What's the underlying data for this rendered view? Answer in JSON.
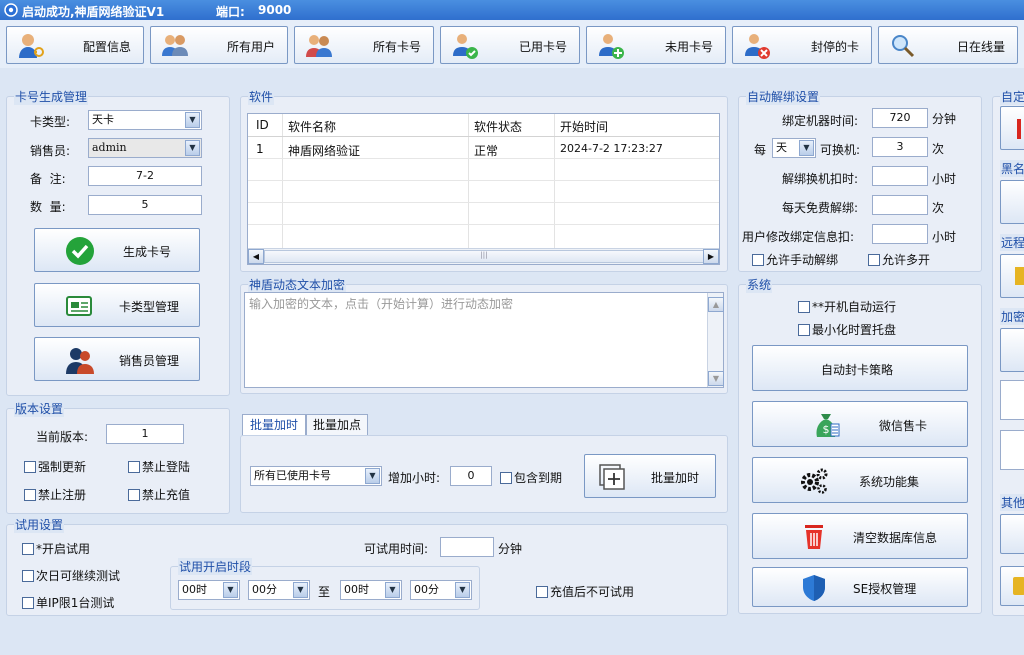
{
  "window": {
    "title": "启动成功,神盾网络验证V1",
    "port_label": "端口:",
    "port_value": "9000"
  },
  "toolbar": [
    {
      "label": "配置信息",
      "icon": "user-key-icon"
    },
    {
      "label": "所有用户",
      "icon": "users-icon"
    },
    {
      "label": "所有卡号",
      "icon": "cards-users-icon"
    },
    {
      "label": "已用卡号",
      "icon": "user-check-icon"
    },
    {
      "label": "未用卡号",
      "icon": "user-add-icon"
    },
    {
      "label": "封停的卡",
      "icon": "user-block-icon"
    },
    {
      "label": "日在线量",
      "icon": "magnifier-icon"
    }
  ],
  "card_gen": {
    "title": "卡号生成管理",
    "type_label": "卡类型:",
    "type_value": "天卡",
    "seller_label": "销售员:",
    "seller_value": "admin",
    "remark_label": "备  注:",
    "remark_value": "7-2",
    "qty_label": "数  量:",
    "qty_value": "5",
    "btn_generate": "生成卡号",
    "btn_cardtype": "卡类型管理",
    "btn_seller": "销售员管理"
  },
  "version": {
    "title": "版本设置",
    "current_label": "当前版本:",
    "current_value": "1",
    "force_update": "强制更新",
    "forbid_login": "禁止登陆",
    "forbid_register": "禁止注册",
    "forbid_recharge": "禁止充值"
  },
  "trial": {
    "title": "试用设置",
    "enable": "*开启试用",
    "next_day": "次日可继续测试",
    "single_ip": "单IP限1台测试",
    "time_label": "可试用时间:",
    "time_value": "",
    "time_unit": "分钟",
    "period_title": "试用开启时段",
    "from_hour": "00时",
    "from_min": "00分",
    "to_label": "至",
    "to_hour": "00时",
    "to_min": "00分",
    "no_trial_after_recharge": "充值后不可试用"
  },
  "software": {
    "title": "软件",
    "columns": [
      "ID",
      "软件名称",
      "软件状态",
      "开始时间"
    ],
    "rows": [
      {
        "id": "1",
        "name": "神盾网络验证",
        "status": "正常",
        "start": "2024-7-2 17:23:27"
      }
    ]
  },
  "encrypt": {
    "title": "神盾动态文本加密",
    "placeholder": "输入加密的文本，点击（开始计算）进行动态加密"
  },
  "batch": {
    "tab_time": "批量加时",
    "tab_point": "批量加点",
    "scope_value": "所有已使用卡号",
    "hours_label": "增加小时:",
    "hours_value": "0",
    "include_expired": "包含到期",
    "btn_batch": "批量加时"
  },
  "auto_unbind": {
    "title": "自动解绑设置",
    "bind_time_label": "绑定机器时间:",
    "bind_time_value": "720",
    "bind_time_unit": "分钟",
    "per_label": "每",
    "per_value": "天",
    "change_label": "可换机:",
    "change_value": "3",
    "change_unit": "次",
    "deduct_label": "解绑换机扣时:",
    "deduct_value": "",
    "deduct_unit": "小时",
    "free_label": "每天免费解绑:",
    "free_value": "",
    "free_unit": "次",
    "modify_label": "用户修改绑定信息扣:",
    "modify_value": "",
    "modify_unit": "小时",
    "allow_manual": "允许手动解绑",
    "allow_multi": "允许多开"
  },
  "system": {
    "title": "系统",
    "autostart": "**开机自动运行",
    "tray": "最小化时置托盘",
    "btn_policy": "自动封卡策略",
    "btn_wechat": "微信售卡",
    "btn_features": "系统功能集",
    "btn_clear": "清空数据库信息",
    "btn_se": "SE授权管理"
  },
  "right_partial": {
    "t1": "自定",
    "t2": "黑名",
    "t3": "远程",
    "t4": "加密",
    "t5": "其他"
  }
}
